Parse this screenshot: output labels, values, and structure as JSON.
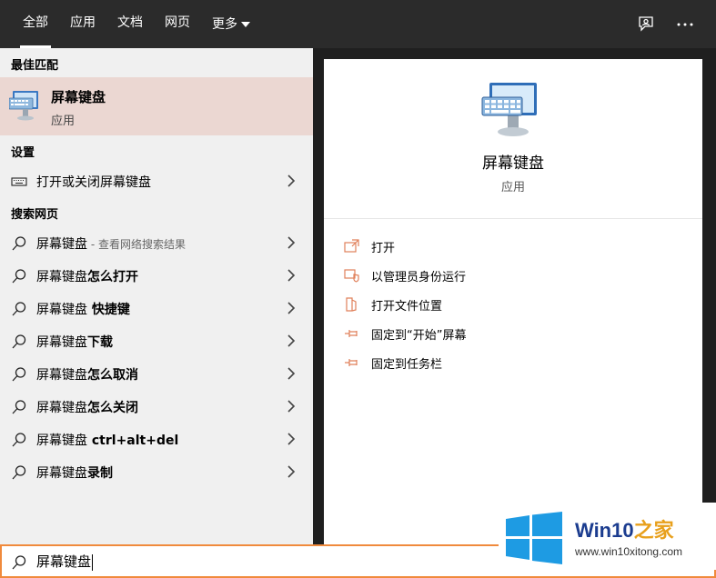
{
  "tabs": [
    {
      "label": "全部",
      "active": true
    },
    {
      "label": "应用"
    },
    {
      "label": "文档"
    },
    {
      "label": "网页"
    },
    {
      "label": "更多"
    }
  ],
  "topbar_icons": [
    "feedback-icon",
    "more-options-icon"
  ],
  "sections": {
    "best_match": "最佳匹配",
    "settings": "设置",
    "web": "搜索网页"
  },
  "best_match": {
    "title": "屏幕键盘",
    "subtitle": "应用",
    "icon": "on-screen-keyboard-icon"
  },
  "settings_items": [
    {
      "label": "打开或关闭屏幕键盘",
      "icon": "keyboard-icon"
    }
  ],
  "web_items": [
    {
      "query": "屏幕键盘",
      "suffix": " - 查看网络搜索结果"
    },
    {
      "query": "屏幕键盘",
      "suffix": "怎么打开"
    },
    {
      "query": "屏幕键盘",
      "suffix": " 快捷键"
    },
    {
      "query": "屏幕键盘",
      "suffix": "下载"
    },
    {
      "query": "屏幕键盘",
      "suffix": "怎么取消"
    },
    {
      "query": "屏幕键盘",
      "suffix": "怎么关闭"
    },
    {
      "query": "屏幕键盘",
      "suffix": " ctrl+alt+del"
    },
    {
      "query": "屏幕键盘",
      "suffix": "录制"
    }
  ],
  "detail": {
    "title": "屏幕键盘",
    "subtitle": "应用",
    "actions": [
      {
        "label": "打开",
        "icon": "open-icon"
      },
      {
        "label": "以管理员身份运行",
        "icon": "shield-icon"
      },
      {
        "label": "打开文件位置",
        "icon": "file-location-icon"
      },
      {
        "label": "固定到“开始”屏幕",
        "icon": "pin-icon"
      },
      {
        "label": "固定到任务栏",
        "icon": "pin-icon"
      }
    ]
  },
  "search": {
    "value": "屏幕键盘"
  },
  "watermark": {
    "brand": "Win10",
    "brand_accent": "之家",
    "url": "www.win10xitong.com"
  },
  "colors": {
    "accent": "#f08a3c",
    "selected": "#ebd7d2",
    "topbar": "#2b2b2b",
    "brand": "#1b3c8f"
  }
}
